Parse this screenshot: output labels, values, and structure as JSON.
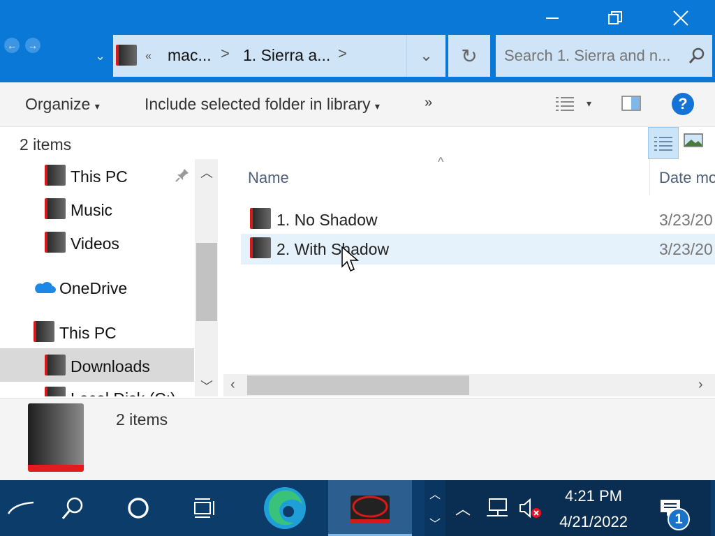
{
  "breadcrumb": {
    "overflow": "«",
    "segment1": "mac...",
    "sep": ">",
    "segment2": "1. Sierra a...",
    "sep2": ">"
  },
  "search": {
    "placeholder": "Search 1. Sierra and n..."
  },
  "ribbon": {
    "organize": "Organize",
    "include_library": "Include selected folder in library",
    "more": "»",
    "dropdown_caret": "▾"
  },
  "header_count": "2 items",
  "nav_pane": {
    "items": [
      {
        "label": "This PC"
      },
      {
        "label": "Music"
      },
      {
        "label": "Videos"
      },
      {
        "label": "OneDrive"
      },
      {
        "label": "This PC"
      },
      {
        "label": "Downloads"
      },
      {
        "label": "Local Disk (C:)"
      }
    ]
  },
  "columns": {
    "name": "Name",
    "date": "Date mo"
  },
  "files": [
    {
      "name": "1. No Shadow",
      "date": "3/23/20"
    },
    {
      "name": "2. With Shadow",
      "date": "3/23/20"
    }
  ],
  "details_pane": {
    "count": "2 items"
  },
  "taskbar": {
    "time": "4:21 PM",
    "date": "4/21/2022",
    "notification_count": "1"
  },
  "colors": {
    "title_blue": "#0a78d6",
    "taskbar": "#0c3d6a",
    "selection": "#e5f1fb",
    "accent_red": "#d51a1a"
  }
}
